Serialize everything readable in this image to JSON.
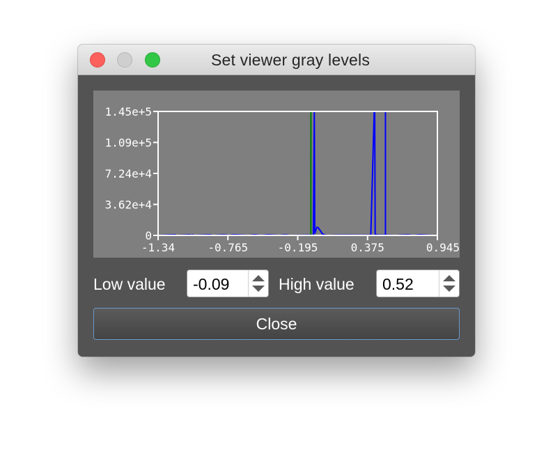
{
  "window": {
    "title": "Set viewer gray levels"
  },
  "chart_data": {
    "type": "line",
    "title": "",
    "xlabel": "",
    "ylabel": "",
    "xlim": [
      -1.34,
      0.945
    ],
    "ylim": [
      0,
      145000
    ],
    "x_ticks": [
      "-1.34",
      "-0.765",
      "-0.195",
      "0.375",
      "0.945"
    ],
    "y_ticks": [
      "0",
      "3.62e+4",
      "7.24e+4",
      "1.09e+5",
      "1.45e+5"
    ],
    "grid": false,
    "series": [
      {
        "color": "#0000ff",
        "x": [
          -1.34,
          -1.2,
          -1.19,
          -1.08,
          -1.07,
          -1.06,
          -1.04,
          -0.92,
          -0.89,
          -0.8,
          -0.76,
          -0.72,
          -0.6,
          -0.55,
          -0.5,
          -0.44,
          -0.35,
          -0.3,
          -0.26,
          -0.1,
          -0.08,
          -0.07,
          -0.062,
          -0.058,
          -0.05,
          -0.04,
          -0.03,
          -0.02,
          -0.01,
          0.0,
          0.01,
          0.02,
          0.05,
          0.1,
          0.2,
          0.3,
          0.4,
          0.428,
          0.432,
          0.436,
          0.46,
          0.55,
          0.6,
          0.7,
          0.75,
          0.8,
          0.9,
          0.945
        ],
        "y": [
          0,
          600,
          0,
          600,
          0,
          600,
          0,
          600,
          0,
          600,
          0,
          600,
          0,
          600,
          0,
          600,
          0,
          600,
          0,
          300,
          0,
          500,
          145000,
          2000,
          6000,
          9500,
          9000,
          7000,
          5000,
          2500,
          1500,
          500,
          0,
          200,
          300,
          200,
          150,
          145000,
          145000,
          800,
          400,
          200,
          0,
          600,
          0,
          600,
          0,
          0
        ]
      }
    ],
    "markers": [
      {
        "x": -0.09,
        "color": "#008000",
        "label": "Low value"
      },
      {
        "x": 0.52,
        "color": "#0000ff",
        "label": "High value"
      }
    ]
  },
  "controls": {
    "low_label": "Low value",
    "low_value": "-0.09",
    "high_label": "High value",
    "high_value": "0.52"
  },
  "close_button": {
    "label": "Close"
  },
  "colors": {
    "panel_bg": "#535353",
    "plot_bg": "#7f7f7f",
    "axis": "#ffffff",
    "histogram": "#0000ff",
    "low_marker": "#008000",
    "high_marker": "#0000ff",
    "button_border": "#6b97c9"
  }
}
